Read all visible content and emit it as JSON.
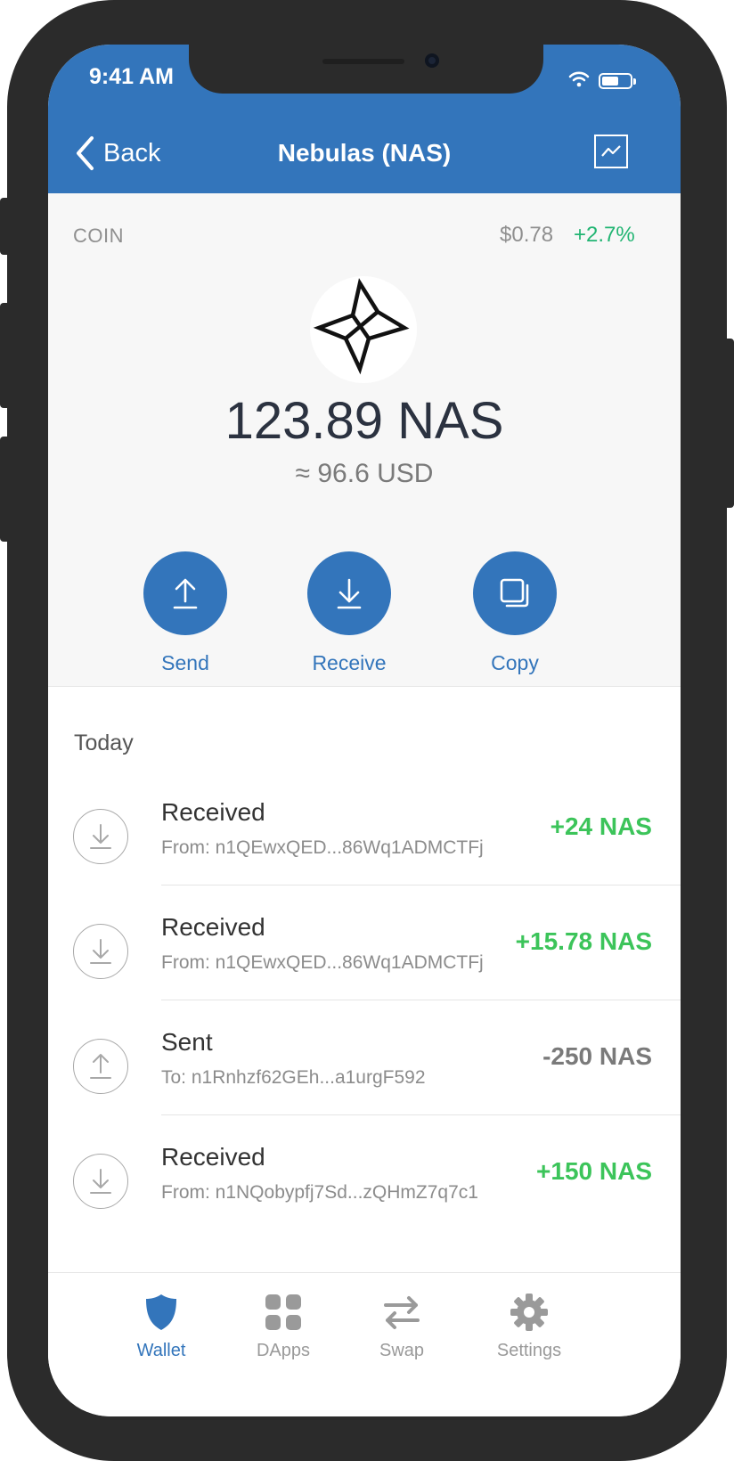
{
  "status_bar": {
    "time": "9:41 AM"
  },
  "nav": {
    "back_label": "Back",
    "title": "Nebulas (NAS)",
    "chart_icon": "chart-line-icon"
  },
  "coin": {
    "type_label": "COIN",
    "price": "$0.78",
    "change": "+2.7%",
    "balance": "123.89 NAS",
    "balance_usd": "≈ 96.6 USD",
    "logo_icon": "nebulas-logo-icon"
  },
  "actions": [
    {
      "label": "Send",
      "icon": "upload-arrow-icon"
    },
    {
      "label": "Receive",
      "icon": "download-arrow-icon"
    },
    {
      "label": "Copy",
      "icon": "copy-icon"
    }
  ],
  "transactions_header": "Today",
  "transactions": [
    {
      "title": "Received",
      "address": "From: n1QEwxQED...86Wq1ADMCTFj",
      "amount": "+24 NAS",
      "direction": "in"
    },
    {
      "title": "Received",
      "address": "From: n1QEwxQED...86Wq1ADMCTFj",
      "amount": "+15.78 NAS",
      "direction": "in"
    },
    {
      "title": "Sent",
      "address": "To: n1Rnhzf62GEh...a1urgF592",
      "amount": "-250 NAS",
      "direction": "out"
    },
    {
      "title": "Received",
      "address": "From: n1NQobypfj7Sd...zQHmZ7q7c1",
      "amount": "+150 NAS",
      "direction": "in"
    }
  ],
  "tabs": [
    {
      "label": "Wallet",
      "icon": "shield-icon",
      "active": true
    },
    {
      "label": "DApps",
      "icon": "grid-icon",
      "active": false
    },
    {
      "label": "Swap",
      "icon": "swap-arrows-icon",
      "active": false
    },
    {
      "label": "Settings",
      "icon": "gear-icon",
      "active": false
    }
  ],
  "colors": {
    "brand_blue": "#3375bb",
    "positive_green": "#22b573",
    "incoming_green": "#3cc45a",
    "outgoing_gray": "#7a7a7a"
  }
}
